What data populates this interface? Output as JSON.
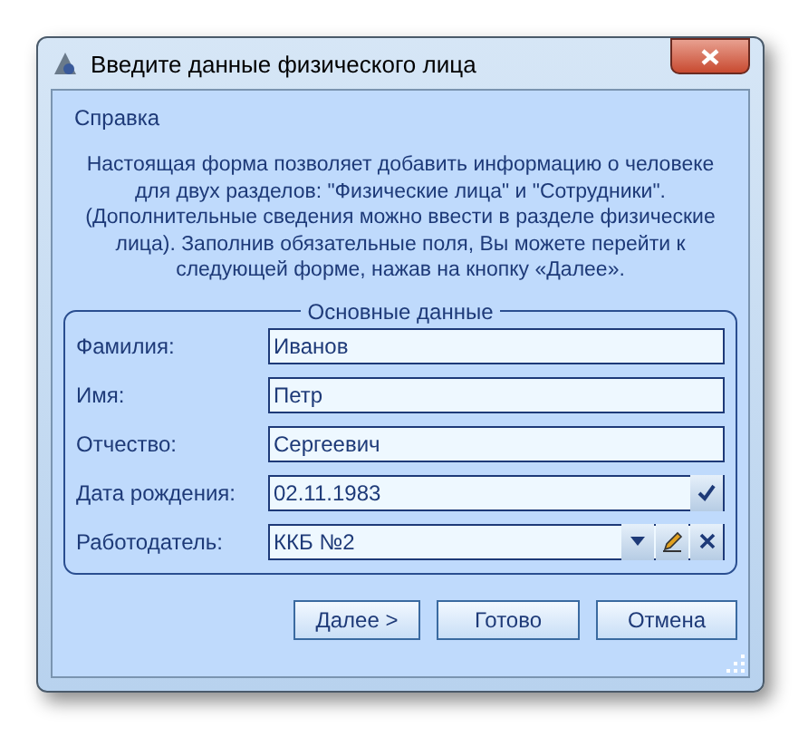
{
  "window": {
    "title": "Введите данные физического лица"
  },
  "help": {
    "title": "Справка",
    "text": "Настоящая форма позволяет добавить информацию о человеке для двух разделов: \"Физические лица\" и \"Сотрудники\". (Дополнительные сведения можно ввести в разделе физические лица). Заполнив обязательные поля, Вы можете перейти к следующей форме, нажав на кнопку «Далее»."
  },
  "group": {
    "title": "Основные данные",
    "fields": [
      {
        "label": "Фамилия:",
        "value": "Иванов",
        "kind": "text"
      },
      {
        "label": "Имя:",
        "value": "Петр",
        "kind": "text"
      },
      {
        "label": "Отчество:",
        "value": "Сергеевич",
        "kind": "text"
      },
      {
        "label": "Дата рождения:",
        "value": "02.11.1983",
        "kind": "date"
      },
      {
        "label": "Работодатель:",
        "value": "ККБ №2",
        "kind": "lookup"
      }
    ]
  },
  "buttons": [
    "Далее >",
    "Готово",
    "Отмена"
  ]
}
